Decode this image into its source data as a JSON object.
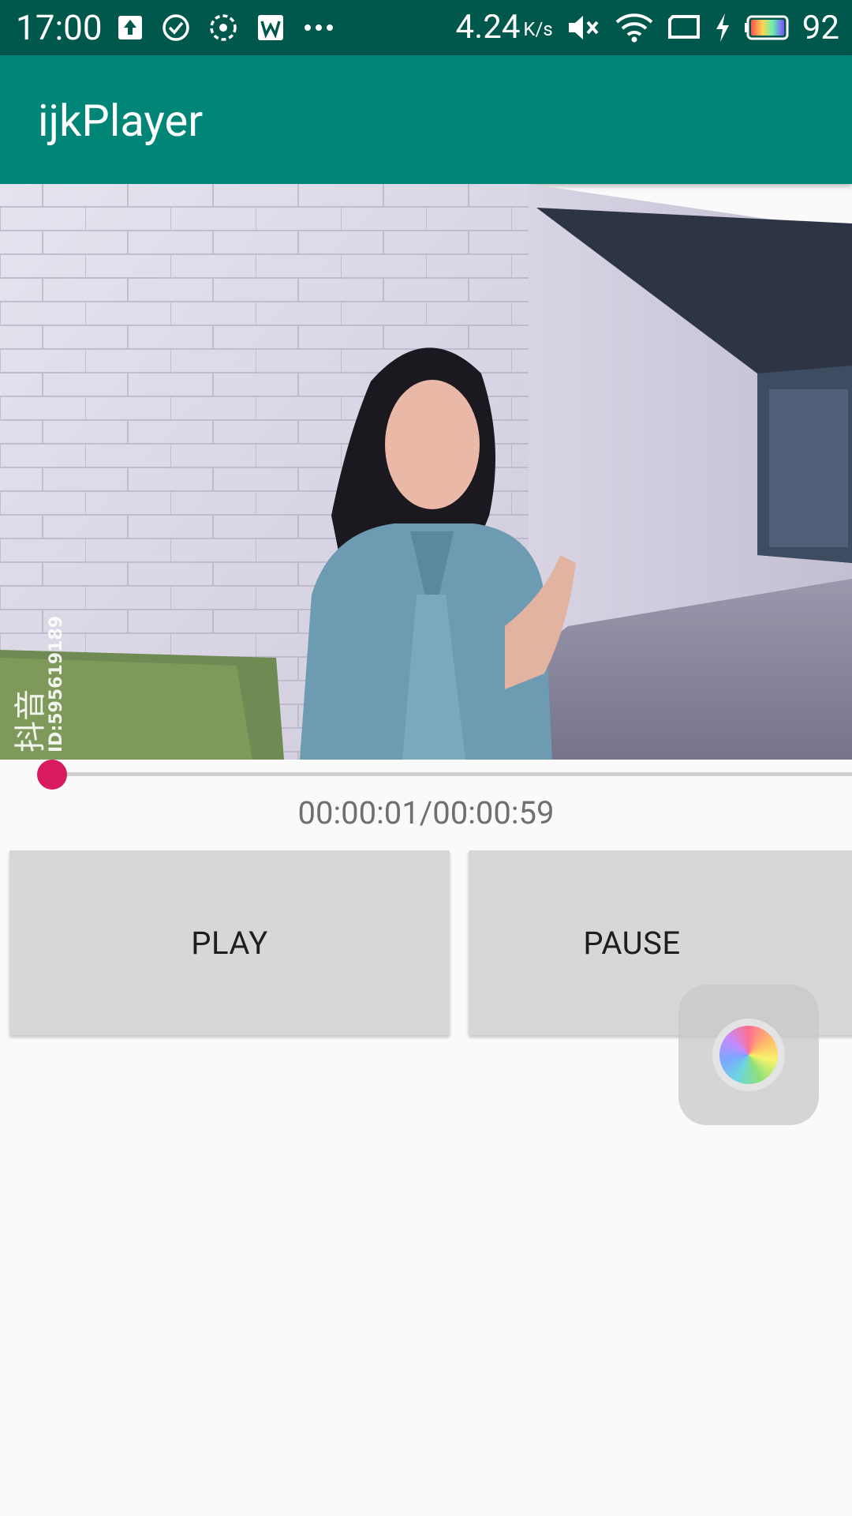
{
  "status_bar": {
    "time": "17:00",
    "network_speed": "4.24",
    "network_speed_unit": "K/s",
    "battery_level": "92",
    "left_icons": [
      "upload-icon",
      "check-circle-icon",
      "sync-dashed-icon",
      "wps-icon",
      "more-dots-icon"
    ],
    "right_icons": [
      "mute-icon",
      "wifi-icon",
      "screen-icon",
      "charging-icon",
      "battery-icon"
    ]
  },
  "app_bar": {
    "title": "ijkPlayer"
  },
  "video": {
    "watermark_app": "抖音",
    "watermark_id": "ID:595619189"
  },
  "player": {
    "time_display": "00:00:01/00:00:59",
    "progress_fraction": 0.017
  },
  "buttons": {
    "play_label": "PLAY",
    "pause_label": "PAUSE"
  },
  "colors": {
    "status_bar": "#00574b",
    "app_bar": "#008577",
    "accent": "#d81b60",
    "background": "#fafafa"
  }
}
